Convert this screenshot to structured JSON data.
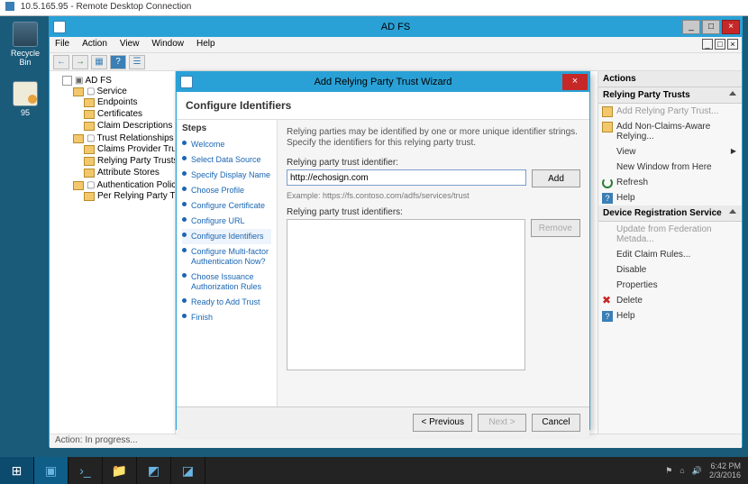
{
  "rdp": {
    "title": "10.5.165.95 - Remote Desktop Connection"
  },
  "desktop_icons": {
    "recycle": "Recycle Bin",
    "mail": "95"
  },
  "mmc": {
    "title": "AD FS",
    "menu": {
      "file": "File",
      "action": "Action",
      "view": "View",
      "window": "Window",
      "help": "Help"
    },
    "tree": {
      "root": "AD FS",
      "service": "Service",
      "endpoints": "Endpoints",
      "certificates": "Certificates",
      "claim_desc": "Claim Descriptions",
      "trust_rel": "Trust Relationships",
      "claims_provider": "Claims Provider Trusts",
      "relying_party": "Relying Party Trusts",
      "attribute_stores": "Attribute Stores",
      "auth_policies": "Authentication Policies",
      "per_rp": "Per Relying Party Trust"
    },
    "status": "Action:  In progress..."
  },
  "actions": {
    "header": "Actions",
    "rpt_header": "Relying Party Trusts",
    "add_rp": "Add Relying Party Trust...",
    "add_non_claims": "Add Non-Claims-Aware Relying...",
    "view": "View",
    "new_window": "New Window from Here",
    "refresh": "Refresh",
    "help": "Help",
    "drs_header": "Device Registration Service",
    "update_fed": "Update from Federation Metada...",
    "edit_claim": "Edit Claim Rules...",
    "disable": "Disable",
    "properties": "Properties",
    "delete": "Delete",
    "help2": "Help"
  },
  "wizard": {
    "title": "Add Relying Party Trust Wizard",
    "header": "Configure Identifiers",
    "steps_label": "Steps",
    "steps": {
      "welcome": "Welcome",
      "select_ds": "Select Data Source",
      "display_name": "Specify Display Name",
      "choose_profile": "Choose Profile",
      "config_cert": "Configure Certificate",
      "config_url": "Configure URL",
      "config_ident": "Configure Identifiers",
      "config_mfa": "Configure Multi-factor Authentication Now?",
      "choose_auth": "Choose Issuance Authorization Rules",
      "ready": "Ready to Add Trust",
      "finish": "Finish"
    },
    "desc": "Relying parties may be identified by one or more unique identifier strings. Specify the identifiers for this relying party trust.",
    "label_identifier": "Relying party trust identifier:",
    "input_value": "http://echosign.com",
    "add_btn": "Add",
    "example": "Example: https://fs.contoso.com/adfs/services/trust",
    "label_list": "Relying party trust identifiers:",
    "remove_btn": "Remove",
    "prev": "< Previous",
    "next": "Next >",
    "cancel": "Cancel"
  },
  "taskbar": {
    "time": "6:42 PM",
    "date": "2/3/2016"
  }
}
